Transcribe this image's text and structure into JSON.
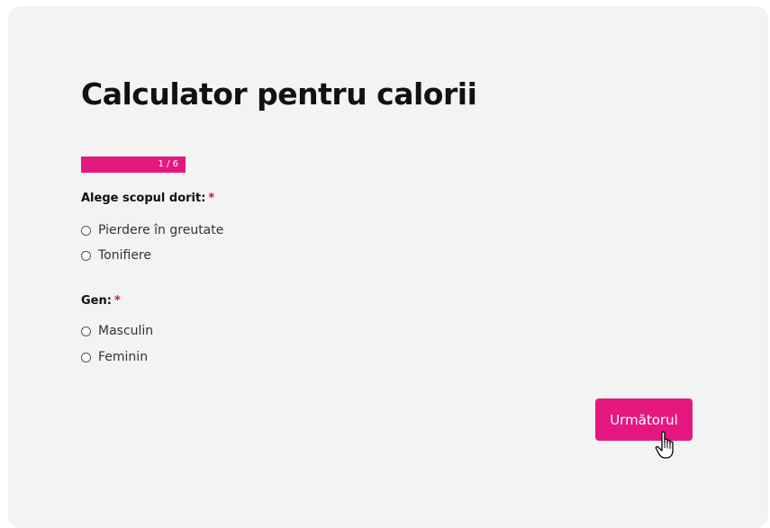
{
  "form": {
    "title": "Calculator pentru calorii",
    "progress": {
      "text": "1 / 6",
      "fraction": 1.0
    },
    "questions": [
      {
        "label": "Alege scopul dorit:",
        "required_mark": "*",
        "options": [
          "Pierdere în greutate",
          "Tonifiere"
        ]
      },
      {
        "label": "Gen:",
        "required_mark": "*",
        "options": [
          "Masculin",
          "Feminin"
        ]
      }
    ],
    "next_button_label": "Următorul"
  },
  "colors": {
    "accent": "#e5187f",
    "card_background": "#f3f3f3",
    "required": "#d0172a"
  },
  "icons": {
    "cursor": "hand-pointer-icon"
  }
}
